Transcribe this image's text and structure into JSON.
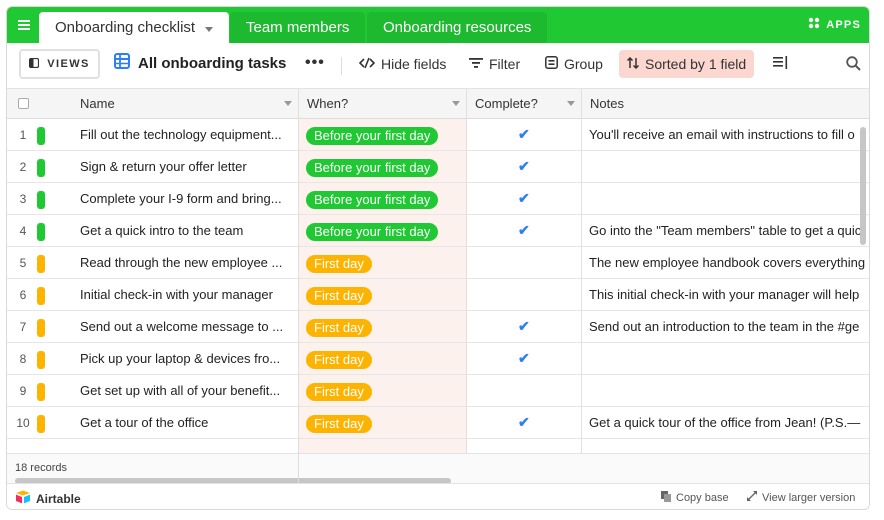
{
  "tabs": [
    {
      "label": "Onboarding checklist",
      "active": true
    },
    {
      "label": "Team members",
      "active": false
    },
    {
      "label": "Onboarding resources",
      "active": false
    }
  ],
  "apps_label": "APPS",
  "toolbar": {
    "views_label": "VIEWS",
    "view_name": "All onboarding tasks",
    "more_label": "•••",
    "hide_fields": "Hide fields",
    "filter": "Filter",
    "group": "Group",
    "sorted": "Sorted by 1 field"
  },
  "columns": {
    "name": "Name",
    "when": "When?",
    "complete": "Complete?",
    "notes": "Notes"
  },
  "colors": {
    "brand_green": "#20c933",
    "pill_green": "#20c933",
    "pill_orange": "#fcb400",
    "pill_blue": "#18bfff",
    "check_blue": "#2d7ff9",
    "sort_bg": "#fbd7cf"
  },
  "rows": [
    {
      "num": "1",
      "name": "Fill out the technology equipment...",
      "when": "Before your first day",
      "color": "green",
      "complete": true,
      "notes": "You'll receive an email with instructions to fill o"
    },
    {
      "num": "2",
      "name": "Sign & return your offer letter",
      "when": "Before your first day",
      "color": "green",
      "complete": true,
      "notes": ""
    },
    {
      "num": "3",
      "name": "Complete your I-9 form and bring...",
      "when": "Before your first day",
      "color": "green",
      "complete": true,
      "notes": ""
    },
    {
      "num": "4",
      "name": "Get a quick intro to the team",
      "when": "Before your first day",
      "color": "green",
      "complete": true,
      "notes": "Go into the \"Team members\" table to get a quic"
    },
    {
      "num": "5",
      "name": "Read through the new employee ...",
      "when": "First day",
      "color": "orange",
      "complete": false,
      "notes": "The new employee handbook covers everything"
    },
    {
      "num": "6",
      "name": "Initial check-in with your manager",
      "when": "First day",
      "color": "orange",
      "complete": false,
      "notes": "This initial check-in with your manager will help"
    },
    {
      "num": "7",
      "name": "Send out a welcome message to ...",
      "when": "First day",
      "color": "orange",
      "complete": true,
      "notes": "Send out an introduction to the team in the #ge"
    },
    {
      "num": "8",
      "name": "Pick up your laptop & devices fro...",
      "when": "First day",
      "color": "orange",
      "complete": true,
      "notes": ""
    },
    {
      "num": "9",
      "name": "Get set up with all of your benefit...",
      "when": "First day",
      "color": "orange",
      "complete": false,
      "notes": ""
    },
    {
      "num": "10",
      "name": "Get a tour of the office",
      "when": "First day",
      "color": "orange",
      "complete": true,
      "notes": "Get a quick tour of the office from Jean! (P.S.—"
    }
  ],
  "records_label": "18 records",
  "brand_name": "Airtable",
  "copy_base": "Copy base",
  "view_larger": "View larger version"
}
